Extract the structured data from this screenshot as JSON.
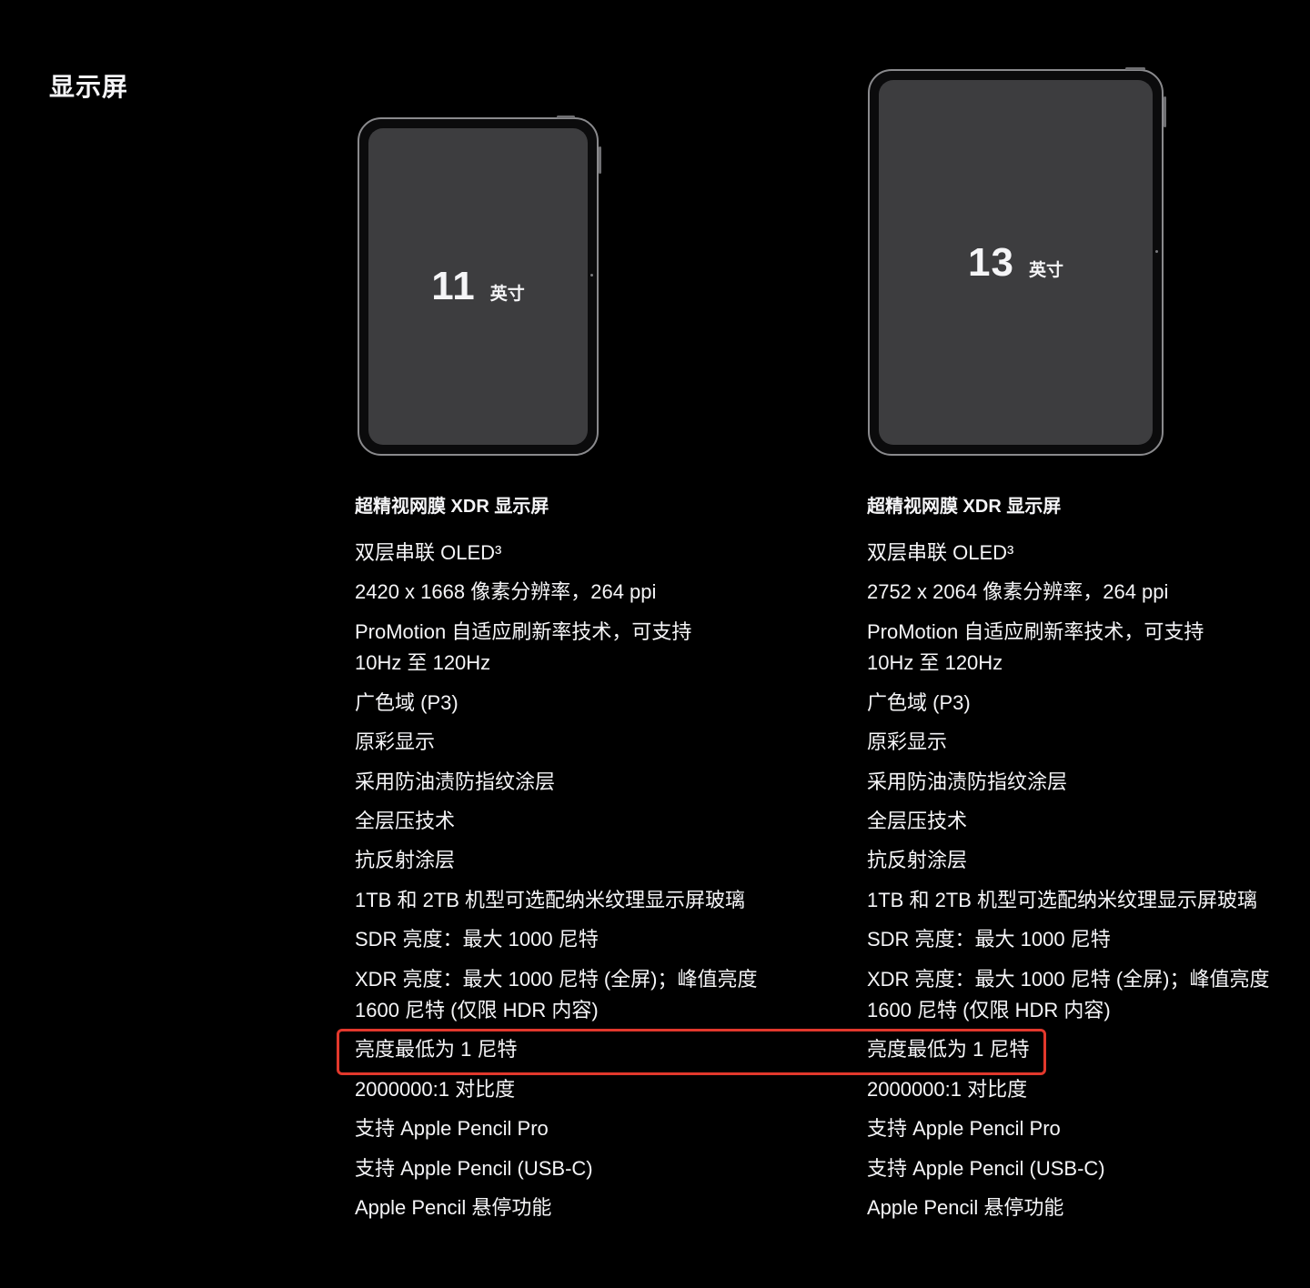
{
  "section": {
    "title": "显示屏"
  },
  "devices": [
    {
      "size_number": "11",
      "size_unit": "英寸",
      "spec_title": "超精视网膜 XDR 显示屏",
      "specs": [
        "双层串联 OLED³",
        "2420 x 1668 像素分辨率，264 ppi",
        "ProMotion 自适应刷新率技术，可支持\n10Hz 至 120Hz",
        "广色域 (P3)",
        "原彩显示",
        "采用防油渍防指纹涂层",
        "全层压技术",
        "抗反射涂层",
        "1TB 和 2TB 机型可选配纳米纹理显示屏玻璃",
        "SDR 亮度：最大 1000 尼特",
        "XDR 亮度：最大 1000 尼特 (全屏)；峰值亮度\n1600 尼特 (仅限 HDR 内容)",
        "亮度最低为 1 尼特",
        "2000000:1 对比度",
        "支持 Apple Pencil Pro",
        "支持 Apple Pencil (USB-C)",
        "Apple Pencil 悬停功能"
      ]
    },
    {
      "size_number": "13",
      "size_unit": "英寸",
      "spec_title": "超精视网膜 XDR 显示屏",
      "specs": [
        "双层串联 OLED³",
        "2752 x 2064 像素分辨率，264 ppi",
        "ProMotion 自适应刷新率技术，可支持\n10Hz 至 120Hz",
        "广色域 (P3)",
        "原彩显示",
        "采用防油渍防指纹涂层",
        "全层压技术",
        "抗反射涂层",
        "1TB 和 2TB 机型可选配纳米纹理显示屏玻璃",
        "SDR 亮度：最大 1000 尼特",
        "XDR 亮度：最大 1000 尼特 (全屏)；峰值亮度\n1600 尼特 (仅限 HDR 内容)",
        "亮度最低为 1 尼特",
        "2000000:1 对比度",
        "支持 Apple Pencil Pro",
        "支持 Apple Pencil (USB-C)",
        "Apple Pencil 悬停功能"
      ]
    }
  ],
  "colors": {
    "background": "#000000",
    "text": "#f5f5f7",
    "screen": "#3d3d3f",
    "bezel": "#8a8a8d",
    "highlight": "#e2382c"
  }
}
